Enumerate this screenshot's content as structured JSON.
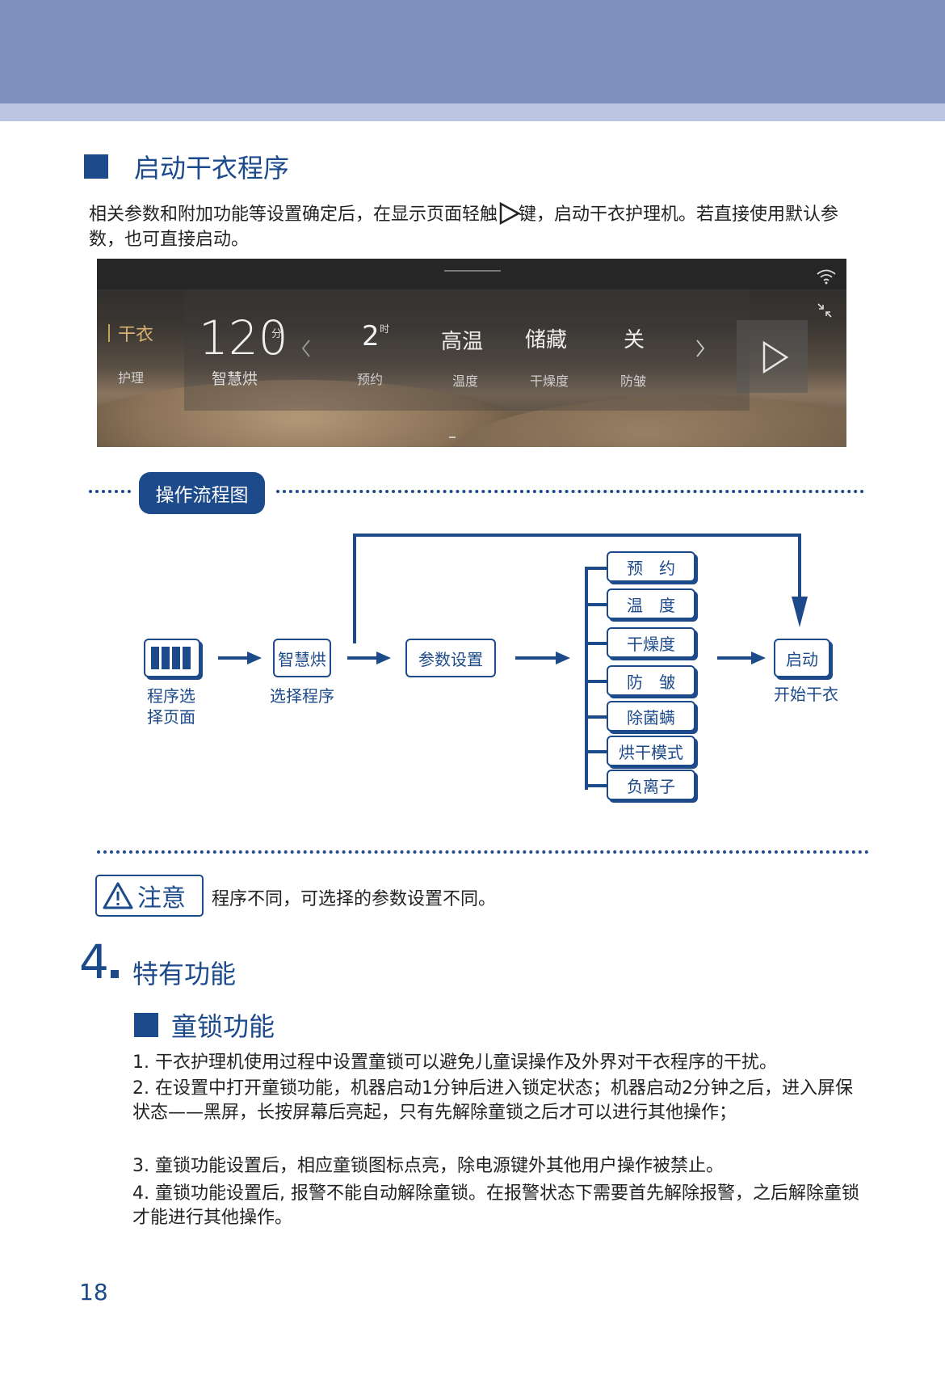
{
  "section": {
    "title": "启动干衣程序"
  },
  "intro": {
    "part1": "相关参数和附加功能等设置确定后，在显示页面轻触",
    "part2": "键，启动干衣护理机。若直接使用默认参数，也可直接启动。"
  },
  "panel": {
    "tab_active": "干衣",
    "tab_other": "护理",
    "time_value": "120",
    "time_unit": "分",
    "program_name": "智慧烘",
    "delay_value": "2",
    "delay_unit": "时",
    "delay_label": "预约",
    "temp_value": "高温",
    "temp_label": "温度",
    "dry_value": "储藏",
    "dry_label": "干燥度",
    "wrinkle_value": "关",
    "wrinkle_label": "防皱"
  },
  "flow": {
    "title": "操作流程图",
    "step1_label_1": "程序选",
    "step1_label_2": "择页面",
    "step2_box": "智慧烘",
    "step2_label": "选择程序",
    "step3_box": "参数设置",
    "params": [
      "预　约",
      "温　度",
      "干燥度",
      "防　皱",
      "除菌螨",
      "烘干模式",
      "负离子"
    ],
    "step5_box": "启动",
    "step5_label": "开始干衣"
  },
  "note": {
    "badge": "注意",
    "text": "程序不同，可选择的参数设置不同。"
  },
  "chapter": {
    "number": "4",
    "title": "特有功能"
  },
  "child_lock": {
    "title": "童锁功能",
    "items": [
      "1. 干衣护理机使用过程中设置童锁可以避免儿童误操作及外界对干衣程序的干扰。",
      "2. 在设置中打开童锁功能，机器启动1分钟后进入锁定状态；机器启动2分钟之后，进入屏保状态——黑屏，长按屏幕后亮起，只有先解除童锁之后才可以进行其他操作；",
      "3. 童锁功能设置后，相应童锁图标点亮，除电源键外其他用户操作被禁止。",
      "4. 童锁功能设置后, 报警不能自动解除童锁。在报警状态下需要首先解除报警，之后解除童锁才能进行其他操作。"
    ]
  },
  "page_number": "18"
}
